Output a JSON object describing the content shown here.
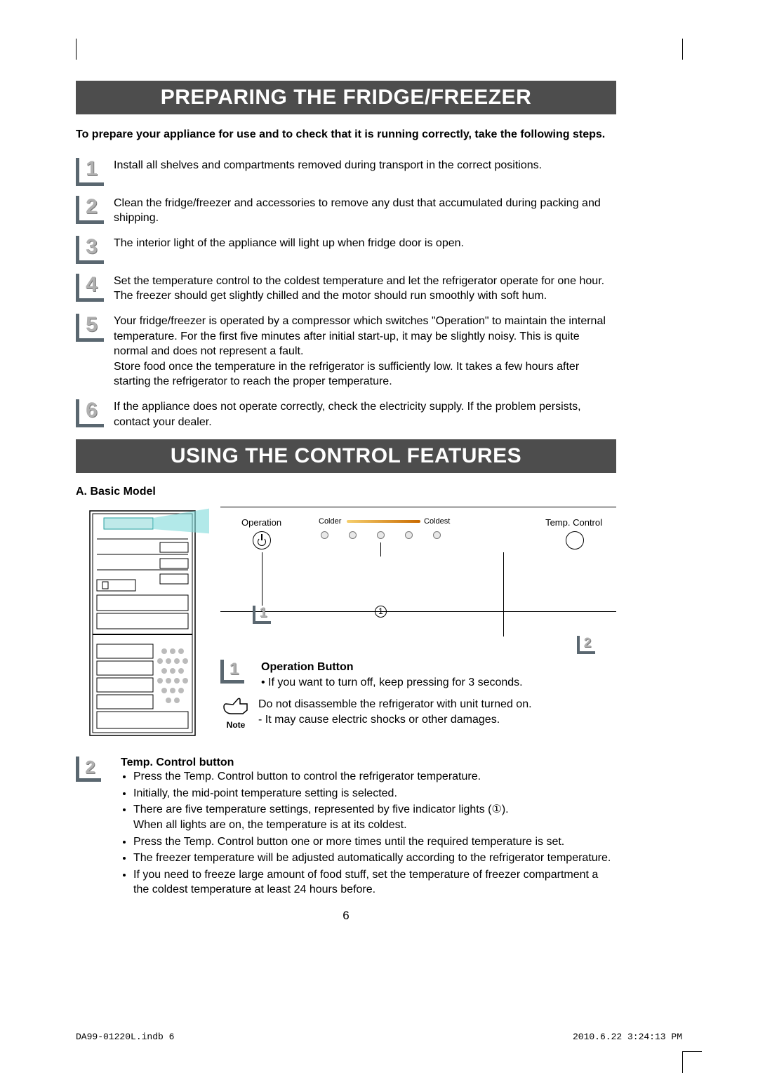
{
  "headings": {
    "h1": "PREPARING THE FRIDGE/FREEZER",
    "h2": "USING THE CONTROL FEATURES"
  },
  "intro": "To prepare your appliance for use and to check that it is running correctly, take the following steps.",
  "steps": [
    {
      "n": "1",
      "text": "Install all shelves and compartments removed during transport in the correct positions."
    },
    {
      "n": "2",
      "text": "Clean the fridge/freezer and accessories to remove any dust that accumulated during packing and shipping."
    },
    {
      "n": "3",
      "text": "The interior light of the appliance will light up when fridge door is open."
    },
    {
      "n": "4",
      "text": "Set the temperature control to the coldest temperature and let the refrigerator operate for one hour. The freezer should get slightly chilled and the motor should run smoothly with soft hum."
    },
    {
      "n": "5",
      "text": "Your fridge/freezer is operated by a compressor which switches \"Operation\" to maintain the internal temperature. For the first five minutes after initial start-up, it may be slightly noisy. This is quite normal and does not represent a fault.\nStore food once the temperature in the refrigerator is sufficiently low. It takes a few hours after starting the refrigerator to reach the proper temperature."
    },
    {
      "n": "6",
      "text": "If the appliance does not operate correctly, check the electricity supply. If the problem persists, contact your dealer."
    }
  ],
  "basic_model": {
    "label": "A. Basic Model",
    "panel_labels": {
      "operation": "Operation",
      "temp_control": "Temp. Control",
      "colder": "Colder",
      "coldest": "Coldest"
    },
    "callout1": "1",
    "callout2": "2",
    "circled_one": "1"
  },
  "operation_button": {
    "num": "1",
    "title": "Operation Button",
    "bullet": "If you want to turn off, keep pressing for 3 seconds."
  },
  "note": {
    "label": "Note",
    "line1": "Do not disassemble the refrigerator with unit turned on.",
    "line2": "- It may cause electric shocks or other damages."
  },
  "temp_control": {
    "num": "2",
    "title": "Temp. Control button",
    "bullets": [
      "Press the Temp. Control button to control the refrigerator temperature.",
      "Initially, the mid-point temperature setting is selected.",
      "There are five temperature settings, represented by five indicator lights (①).",
      "Press the Temp. Control button one or more times until the required temperature is set.",
      "The freezer temperature will be adjusted automatically according to the refrigerator temperature.",
      "If you need to freeze large amount of food stuff, set the temperature of freezer compartment a the coldest temperature at least 24 hours before."
    ],
    "bullet3_cont": "When all lights are on, the temperature is at its coldest."
  },
  "page_number": "6",
  "footer": {
    "left": "DA99-01220L.indb   6",
    "right": "2010.6.22   3:24:13 PM"
  }
}
